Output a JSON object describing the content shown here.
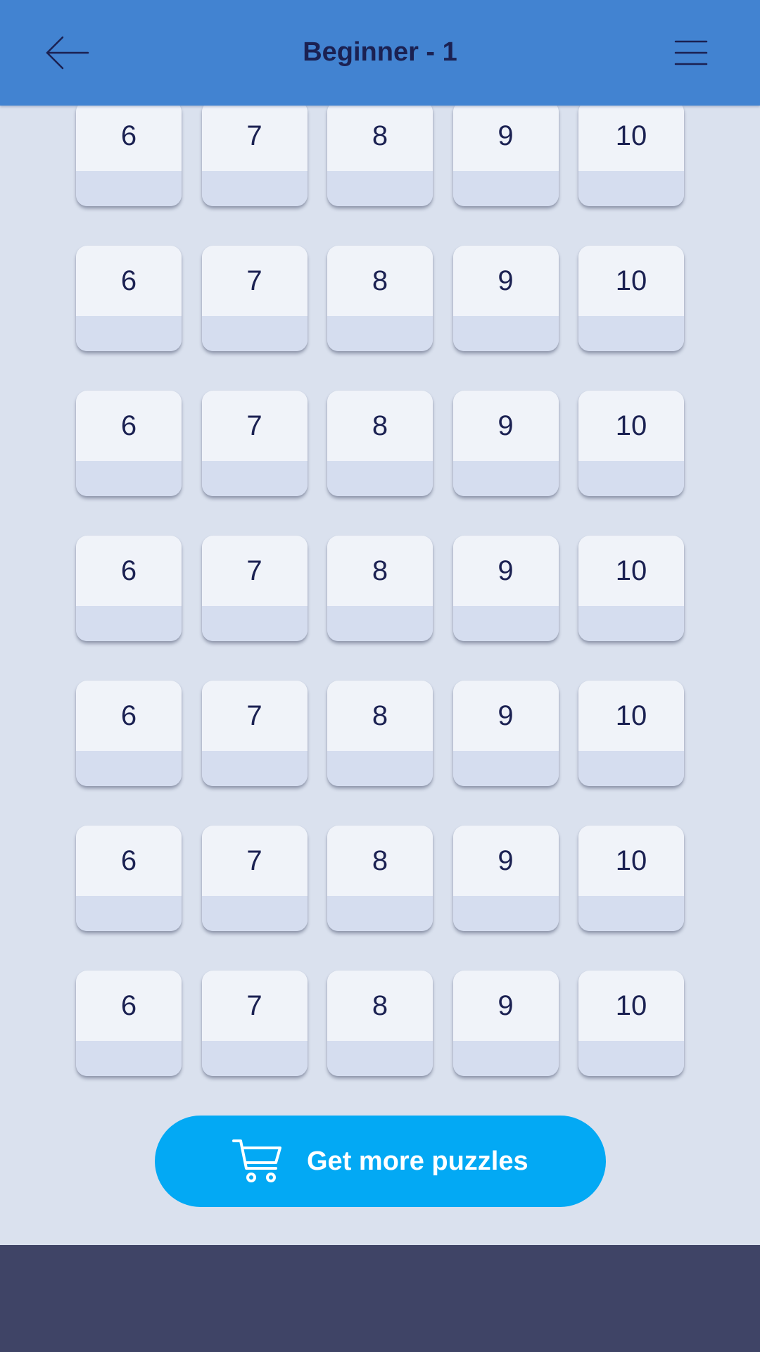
{
  "header": {
    "title": "Beginner - 1",
    "back_icon": "arrow-left-icon",
    "menu_icon": "hamburger-menu-icon"
  },
  "puzzle_grid": {
    "rows": [
      [
        "6",
        "7",
        "8",
        "9",
        "10"
      ],
      [
        "6",
        "7",
        "8",
        "9",
        "10"
      ],
      [
        "6",
        "7",
        "8",
        "9",
        "10"
      ],
      [
        "6",
        "7",
        "8",
        "9",
        "10"
      ],
      [
        "6",
        "7",
        "8",
        "9",
        "10"
      ],
      [
        "6",
        "7",
        "8",
        "9",
        "10"
      ],
      [
        "6",
        "7",
        "8",
        "9",
        "10"
      ]
    ]
  },
  "cta": {
    "label": "Get more puzzles",
    "icon": "shopping-cart-icon"
  },
  "colors": {
    "app_bar": "#4283d1",
    "background": "#dae1ee",
    "tile_top": "#f0f3f9",
    "tile_bottom": "#d5ddef",
    "text_dark": "#1b2152",
    "cta": "#03a9f4",
    "bottom_bar": "#3f4466"
  }
}
